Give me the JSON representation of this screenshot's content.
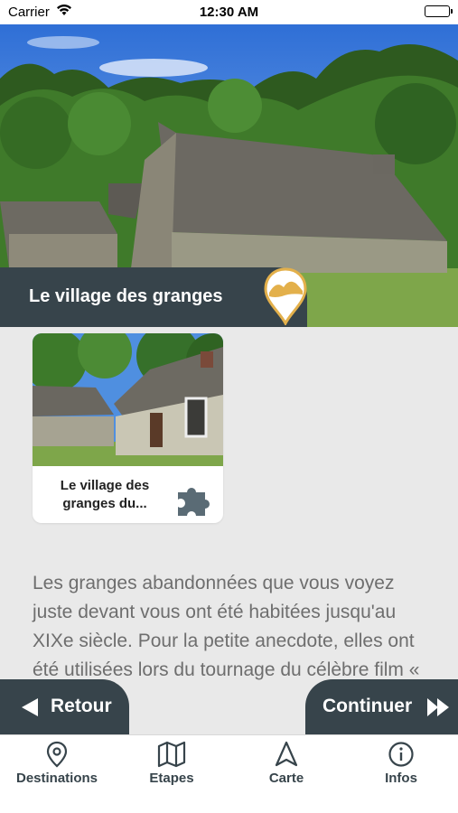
{
  "status_bar": {
    "carrier": "Carrier",
    "time": "12:30 AM"
  },
  "header": {
    "title": "Le village des granges"
  },
  "card": {
    "title": "Le village des granges du..."
  },
  "description": "Les granges abandonnées que vous voyez juste devant vous ont été habitées jusqu'au XIXe siècle. Pour la petite anecdote, elles ont été utilisées lors du tournage du célèbre film « le",
  "nav_buttons": {
    "back_label": "Retour",
    "next_label": "Continuer"
  },
  "tabs": [
    {
      "label": "Destinations",
      "icon": "map-pin-icon"
    },
    {
      "label": "Etapes",
      "icon": "map-icon"
    },
    {
      "label": "Carte",
      "icon": "navigation-icon"
    },
    {
      "label": "Infos",
      "icon": "info-icon"
    }
  ],
  "colors": {
    "primary_dark": "#37444b",
    "accent_gold": "#e3b04b",
    "text_gray": "#6e6e6e",
    "background": "#e9e9e9"
  }
}
